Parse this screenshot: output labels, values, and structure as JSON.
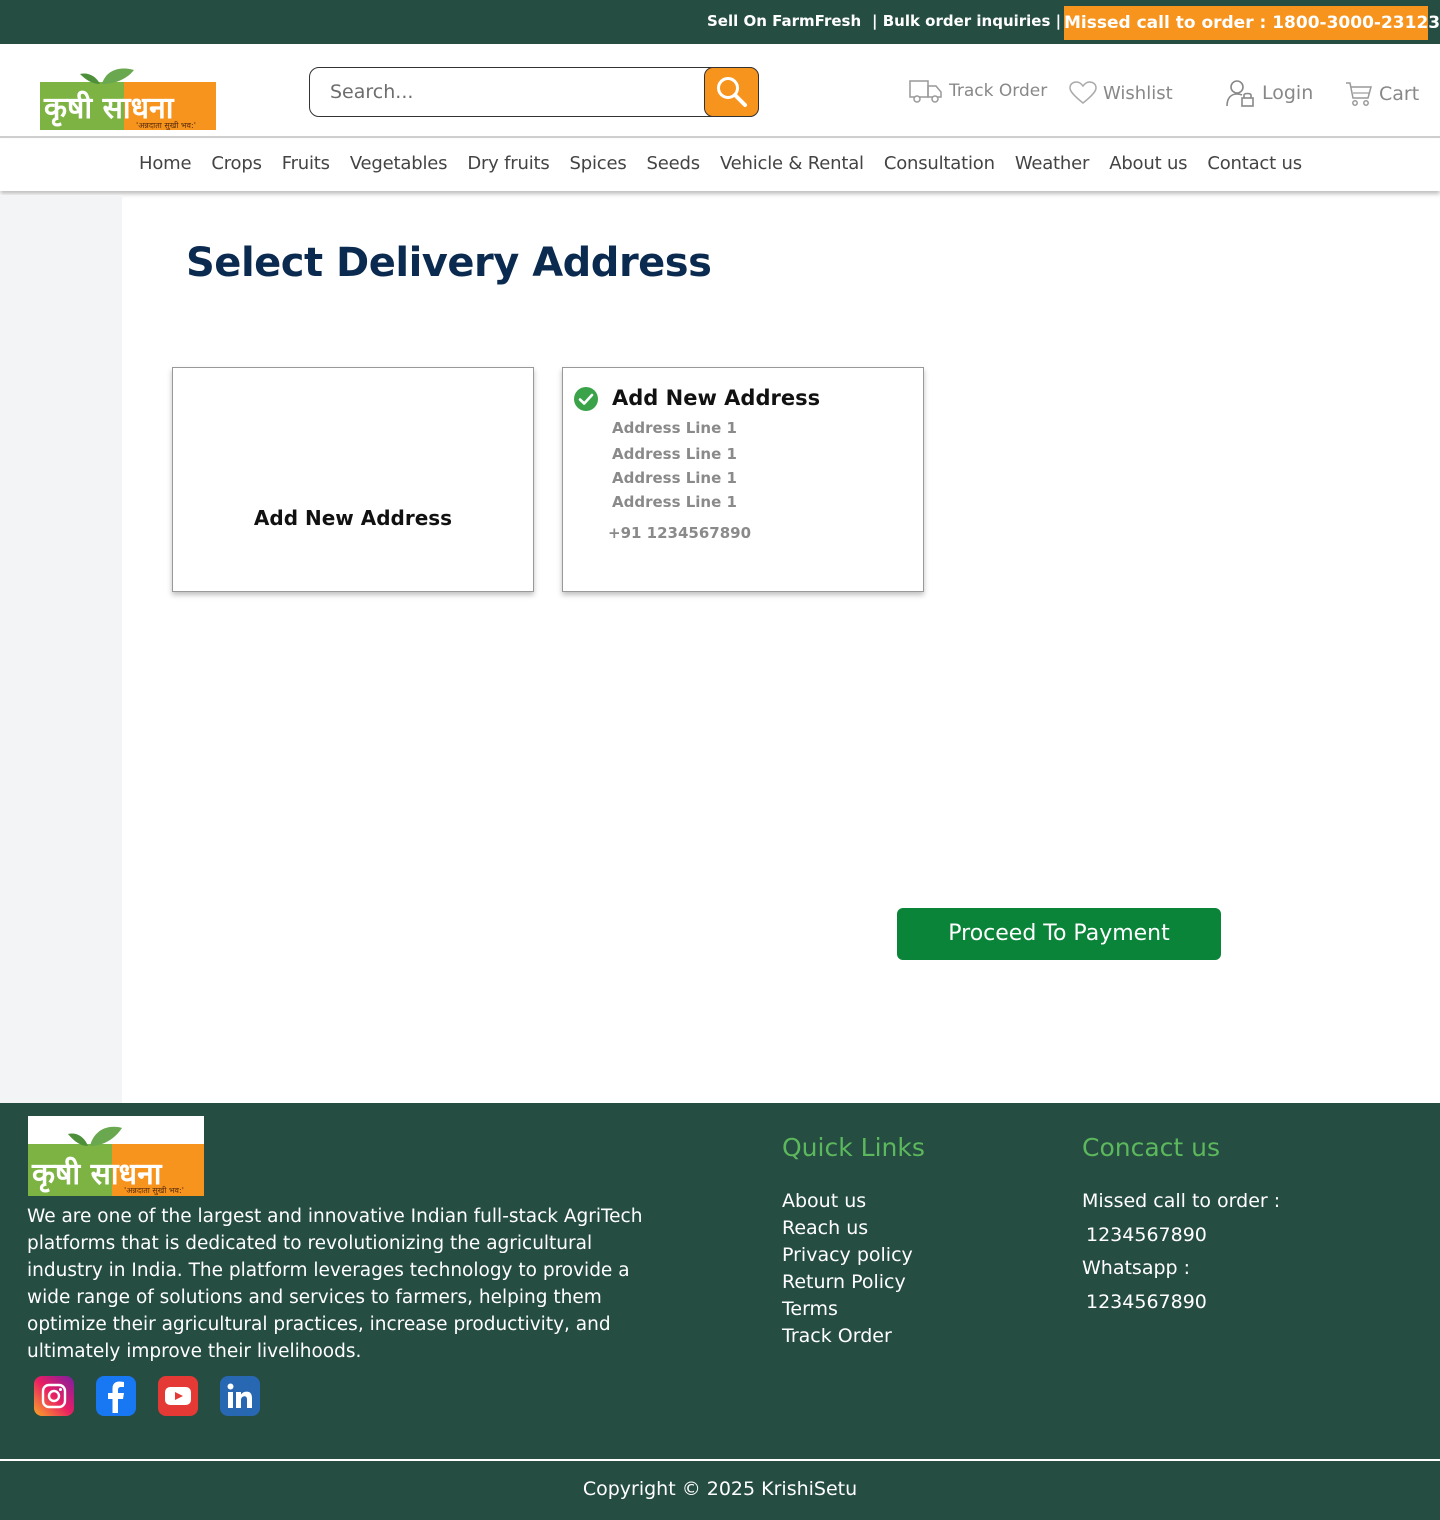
{
  "topbar": {
    "sell": "Sell On FarmFresh",
    "bulk": "| Bulk order inquiries |",
    "missed_call": "Missed call to order : 1800-3000-23123"
  },
  "brand": {
    "logo_text": "कृषी साधना",
    "tagline": "'अन्नदाता सुखी भव:'",
    "colors": {
      "green": "#7cb342",
      "orange": "#f7941d",
      "dark_green": "#264d42",
      "navy": "#0b2a4f"
    }
  },
  "header": {
    "search_placeholder": "Search...",
    "track_order": "Track Order",
    "wishlist": "Wishlist",
    "login": "Login",
    "cart": "Cart"
  },
  "nav": {
    "items": [
      "Home",
      "Crops",
      "Fruits",
      "Vegetables",
      "Dry fruits",
      "Spices",
      "Seeds",
      "Vehicle & Rental",
      "Consultation",
      "Weather",
      "About us",
      "Contact us"
    ]
  },
  "main": {
    "title": "Select Delivery Address",
    "add_card_label": "Add New Address",
    "address_card": {
      "title": "Add New Address",
      "lines": [
        "Address Line 1",
        "Address Line 1",
        "Address Line 1",
        "Address Line 1"
      ],
      "phone": "+91 1234567890",
      "selected": true
    },
    "proceed_button": "Proceed To Payment"
  },
  "footer": {
    "about": "We are one of the largest and innovative Indian full-stack AgriTech platforms that is dedicated to revolutionizing the agricultural industry in India. The platform leverages technology to provide a wide range of solutions and services to farmers, helping them optimize their agricultural practices, increase productivity, and ultimately improve their livelihoods.",
    "socials": [
      "instagram-icon",
      "facebook-icon",
      "youtube-icon",
      "linkedin-icon"
    ],
    "quick_links_title": "Quick Links",
    "quick_links": [
      "About us",
      "Reach us",
      "Privacy policy",
      "Return Policy",
      "Terms",
      "Track Order"
    ],
    "contact_title": "Concact us",
    "missed_call_label": "Missed call to order :",
    "missed_call_number": "1234567890",
    "whatsapp_label": "Whatsapp :",
    "whatsapp_number": "1234567890",
    "copyright": "Copyright © 2025 KrishiSetu"
  }
}
